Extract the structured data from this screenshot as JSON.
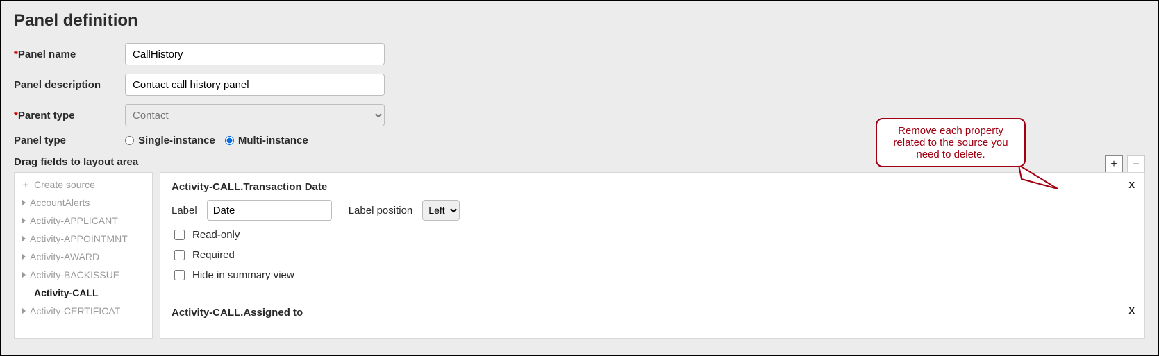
{
  "title": "Panel definition",
  "form": {
    "panelName": {
      "label": "Panel name",
      "value": "CallHistory",
      "required": true
    },
    "panelDesc": {
      "label": "Panel description",
      "value": "Contact call history panel",
      "required": false
    },
    "parentType": {
      "label": "Parent type",
      "value": "Contact",
      "required": true
    },
    "panelType": {
      "label": "Panel type",
      "options": {
        "single": "Single-instance",
        "multi": "Multi-instance"
      },
      "selected": "multi"
    }
  },
  "dragLabel": "Drag fields to layout area",
  "sidebar": {
    "createSource": "Create source",
    "items": [
      {
        "label": "AccountAlerts",
        "active": false
      },
      {
        "label": "Activity-APPLICANT",
        "active": false
      },
      {
        "label": "Activity-APPOINTMNT",
        "active": false
      },
      {
        "label": "Activity-AWARD",
        "active": false
      },
      {
        "label": "Activity-BACKISSUE",
        "active": false
      },
      {
        "label": "Activity-CALL",
        "active": true
      },
      {
        "label": "Activity-CERTIFICAT",
        "active": false
      }
    ]
  },
  "props": {
    "block1": {
      "title": "Activity-CALL.Transaction Date",
      "labelField": {
        "label": "Label",
        "value": "Date"
      },
      "labelPosField": {
        "label": "Label position",
        "value": "Left"
      },
      "readOnly": {
        "label": "Read-only",
        "checked": false
      },
      "required": {
        "label": "Required",
        "checked": false
      },
      "hideSummary": {
        "label": "Hide in summary view",
        "checked": false
      }
    },
    "block2": {
      "title": "Activity-CALL.Assigned to"
    }
  },
  "callout": {
    "line1": "Remove each property",
    "line2": "related to the source you",
    "line3": "need to delete."
  }
}
